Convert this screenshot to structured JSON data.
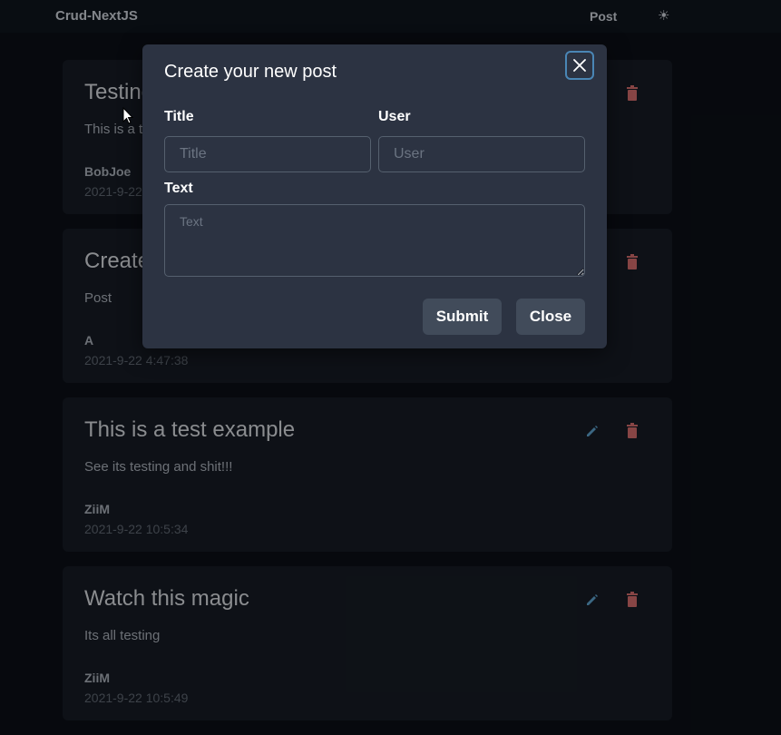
{
  "navbar": {
    "brand": "Crud-NextJS",
    "post_link": "Post",
    "theme_icon": "sun-icon",
    "theme_glyph": "☀"
  },
  "posts": [
    {
      "title": "Testing",
      "text": "This is a test",
      "user": "BobJoe",
      "date": "2021-9-22"
    },
    {
      "title": "Create",
      "text": "Post",
      "user": "A",
      "date": "2021-9-22 4:47:38"
    },
    {
      "title": "This is a test example",
      "text": "See its testing and shit!!!",
      "user": "ZiiM",
      "date": "2021-9-22 10:5:34"
    },
    {
      "title": "Watch this magic",
      "text": "Its all testing",
      "user": "ZiiM",
      "date": "2021-9-22 10:5:49"
    }
  ],
  "modal": {
    "title": "Create your new post",
    "title_label": "Title",
    "title_placeholder": "Title",
    "title_value": "",
    "user_label": "User",
    "user_placeholder": "User",
    "user_value": "",
    "text_label": "Text",
    "text_placeholder": "Text",
    "text_value": "",
    "submit_label": "Submit",
    "close_label": "Close"
  },
  "colors": {
    "background": "#0b0f16",
    "card": "#161b24",
    "modal": "#2c3342",
    "button": "#414b5a",
    "edit_icon": "#5b9ec9",
    "delete_icon": "#d06b6b",
    "focus_ring": "#4a86b5"
  }
}
